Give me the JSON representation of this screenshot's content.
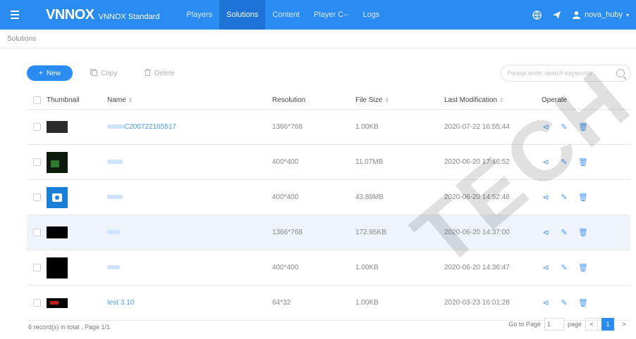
{
  "brand": {
    "logo_text": "VNNOX",
    "edition": "VNNOX Standard",
    "primary_color": "#2a8bf0",
    "active_nav_color": "#1d72d6",
    "link_color": "#4a9af5"
  },
  "nav": {
    "items": [
      {
        "label": "Players",
        "active": false
      },
      {
        "label": "Solutions",
        "active": true
      },
      {
        "label": "Content",
        "active": false
      },
      {
        "label": "Player C--",
        "active": false
      },
      {
        "label": "Logs",
        "active": false
      }
    ]
  },
  "topbar_right": {
    "icons": [
      "globe-icon",
      "send-icon",
      "user-icon"
    ],
    "username": "nova_huby"
  },
  "breadcrumb": "Solutions",
  "toolbar": {
    "new_label": "New",
    "copy_label": "Copy",
    "delete_label": "Delete",
    "search_placeholder": "Please enter search keywords"
  },
  "table": {
    "headers": {
      "thumbnail": "Thumbnail",
      "name": "Name",
      "resolution": "Resolution",
      "file_size": "File Size",
      "last_modification": "Last Modification",
      "operate": "Operate"
    },
    "rows": [
      {
        "name": "C200722165517",
        "resolution": "1366*768",
        "file_size": "1.00KB",
        "modified": "2020-07-22 16:55:44",
        "thumb": "dark-gray",
        "highlight": false
      },
      {
        "name": "",
        "resolution": "400*400",
        "file_size": "11.07MB",
        "modified": "2020-06-20 17:46:52",
        "thumb": "green-image",
        "highlight": false
      },
      {
        "name": "",
        "resolution": "400*400",
        "file_size": "43.89MB",
        "modified": "2020-06-20 14:52:46",
        "thumb": "blue-video",
        "highlight": false
      },
      {
        "name": "",
        "resolution": "1366*768",
        "file_size": "172.95KB",
        "modified": "2020-06-20 14:37:00",
        "thumb": "black-wide",
        "highlight": true
      },
      {
        "name": "",
        "resolution": "400*400",
        "file_size": "1.00KB",
        "modified": "2020-06-20 14:36:47",
        "thumb": "black",
        "highlight": false
      },
      {
        "name": "test 3.10",
        "resolution": "64*32",
        "file_size": "1.00KB",
        "modified": "2020-03-23 16:01:28",
        "thumb": "red-text",
        "highlight": false
      }
    ]
  },
  "footer": {
    "total_text": "6 record(s) in total , Page 1/1",
    "go_to_label": "Go to Page",
    "page_value": "1",
    "page_suffix": "page",
    "current_page": "1",
    "prev": "<",
    "next": ">"
  },
  "watermark": "TECH CO"
}
